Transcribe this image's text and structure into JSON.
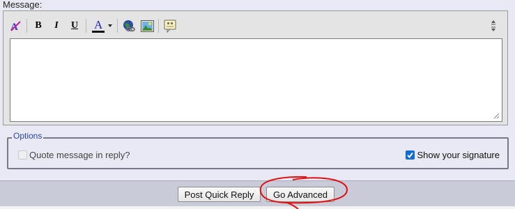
{
  "message_label": "Message:",
  "toolbar": {
    "items": [
      {
        "icon": "remove-format-icon"
      },
      {
        "label": "B"
      },
      {
        "label": "I"
      },
      {
        "label": "U"
      },
      {
        "label": "A",
        "icon": "font-color-icon"
      },
      {
        "icon": "insert-link-icon"
      },
      {
        "icon": "insert-image-icon"
      },
      {
        "icon": "quote-icon"
      }
    ],
    "resize_icon": "resize-toggle-icon"
  },
  "message_text": "",
  "options": {
    "legend": "Options",
    "quote_label": "Quote message in reply?",
    "quote_checked": false,
    "quote_disabled": true,
    "signature_label": "Show your signature",
    "signature_checked": true
  },
  "buttons": {
    "post_quick_reply": "Post Quick Reply",
    "go_advanced": "Go Advanced"
  },
  "colors": {
    "background": "#e8e9f4",
    "options_legend": "#2f44a9",
    "checkbox_checked": "#0f6ad6",
    "annotation": "#e01010"
  }
}
